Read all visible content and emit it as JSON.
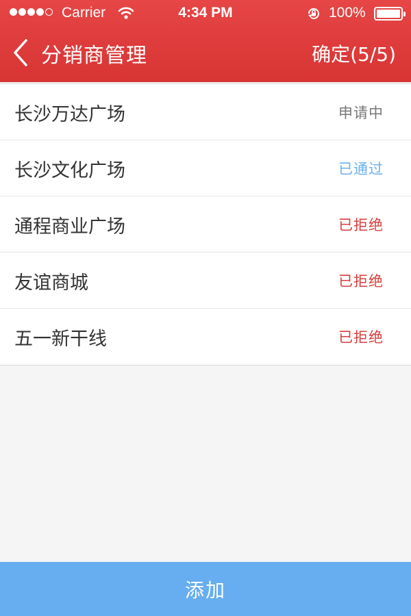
{
  "status_bar": {
    "carrier": "Carrier",
    "time": "4:34 PM",
    "battery_percent": "100%",
    "signal_bars_filled": 4,
    "signal_bars_total": 5
  },
  "nav": {
    "back_icon": "chevron-left-icon",
    "title": "分销商管理",
    "confirm_label": "确定(5/5)"
  },
  "colors": {
    "header_red": "#e04040",
    "pending_gray": "#777777",
    "approved_blue": "#6ab0ee",
    "rejected_red": "#d93c3c",
    "add_button_blue": "#66aef0"
  },
  "distributors": [
    {
      "name": "长沙万达广场",
      "status": "申请中"
    },
    {
      "name": "长沙文化广场",
      "status": "已通过"
    },
    {
      "name": "通程商业广场",
      "status": "已拒绝"
    },
    {
      "name": "友谊商城",
      "status": "已拒绝"
    },
    {
      "name": "五一新干线",
      "status": "已拒绝"
    }
  ],
  "footer": {
    "add_label": "添加"
  }
}
